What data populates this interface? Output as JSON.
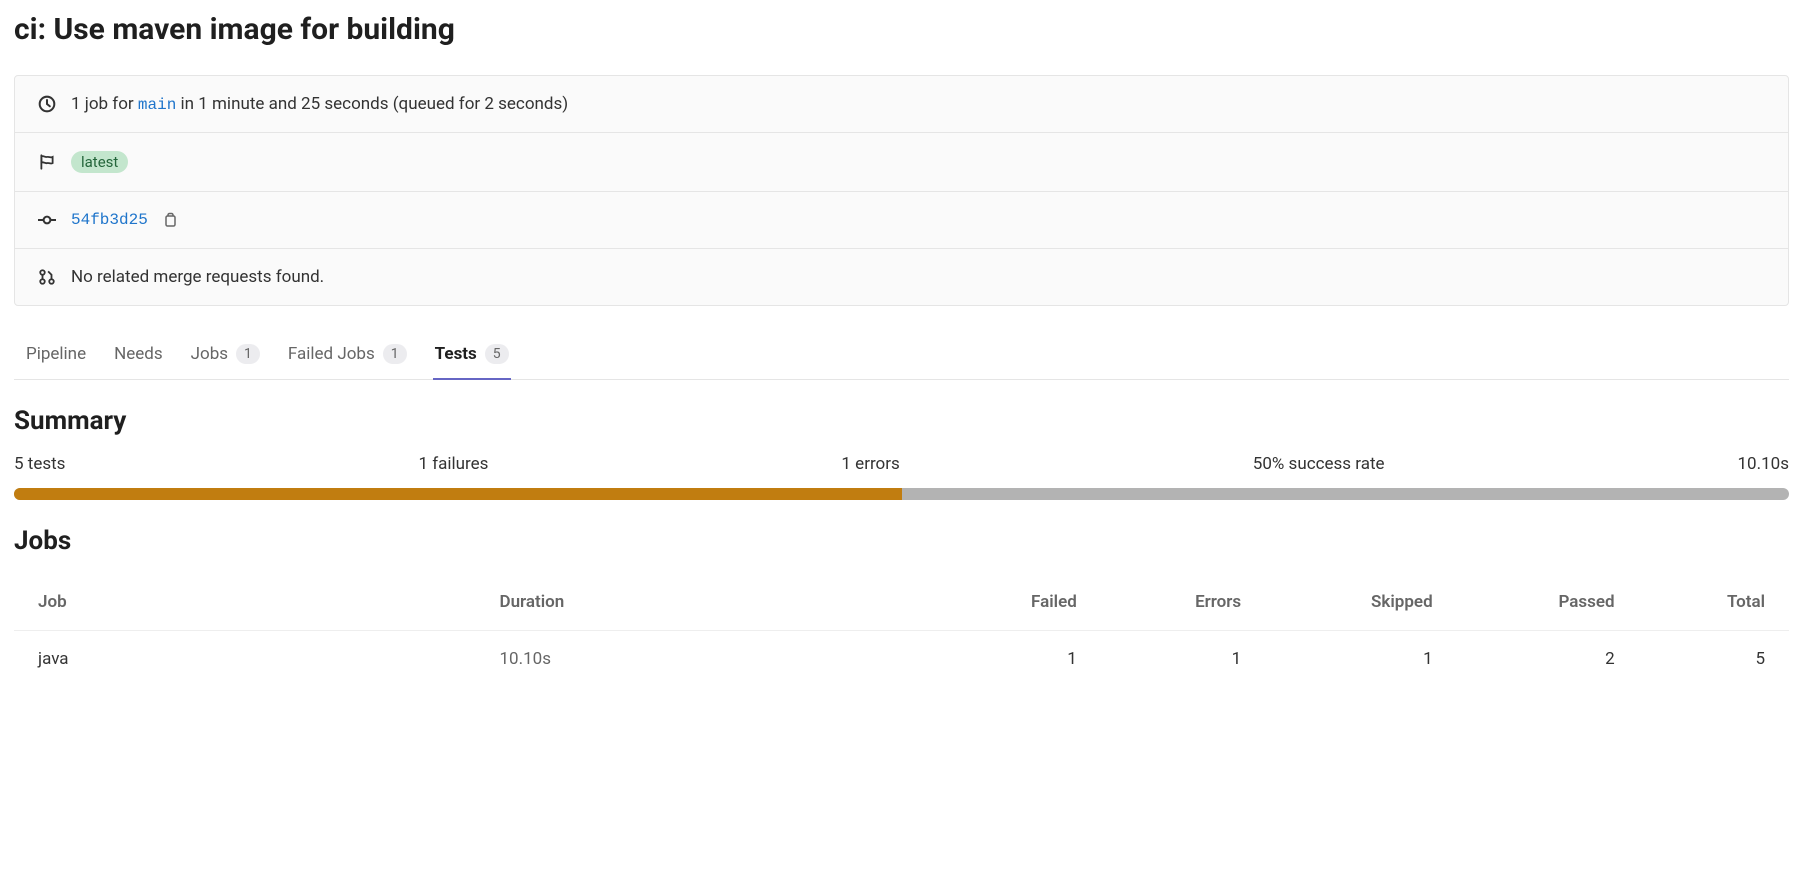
{
  "title": "ci: Use maven image for building",
  "info": {
    "jobs_prefix": "1 job for ",
    "branch": "main",
    "jobs_suffix": " in 1 minute and 25 seconds (queued for 2 seconds)",
    "tag": "latest",
    "commit": "54fb3d25",
    "mr_text": "No related merge requests found."
  },
  "tabs": {
    "pipeline": "Pipeline",
    "needs": "Needs",
    "jobs": "Jobs",
    "jobs_count": "1",
    "failed_jobs": "Failed Jobs",
    "failed_jobs_count": "1",
    "tests": "Tests",
    "tests_count": "5"
  },
  "summary": {
    "heading": "Summary",
    "tests": "5 tests",
    "failures": "1 failures",
    "errors": "1 errors",
    "success_rate": "50% success rate",
    "time": "10.10s",
    "progress_percent": 50
  },
  "jobs": {
    "heading": "Jobs",
    "headers": {
      "job": "Job",
      "duration": "Duration",
      "failed": "Failed",
      "errors": "Errors",
      "skipped": "Skipped",
      "passed": "Passed",
      "total": "Total"
    },
    "rows": [
      {
        "job": "java",
        "duration": "10.10s",
        "failed": "1",
        "errors": "1",
        "skipped": "1",
        "passed": "2",
        "total": "5"
      }
    ]
  }
}
